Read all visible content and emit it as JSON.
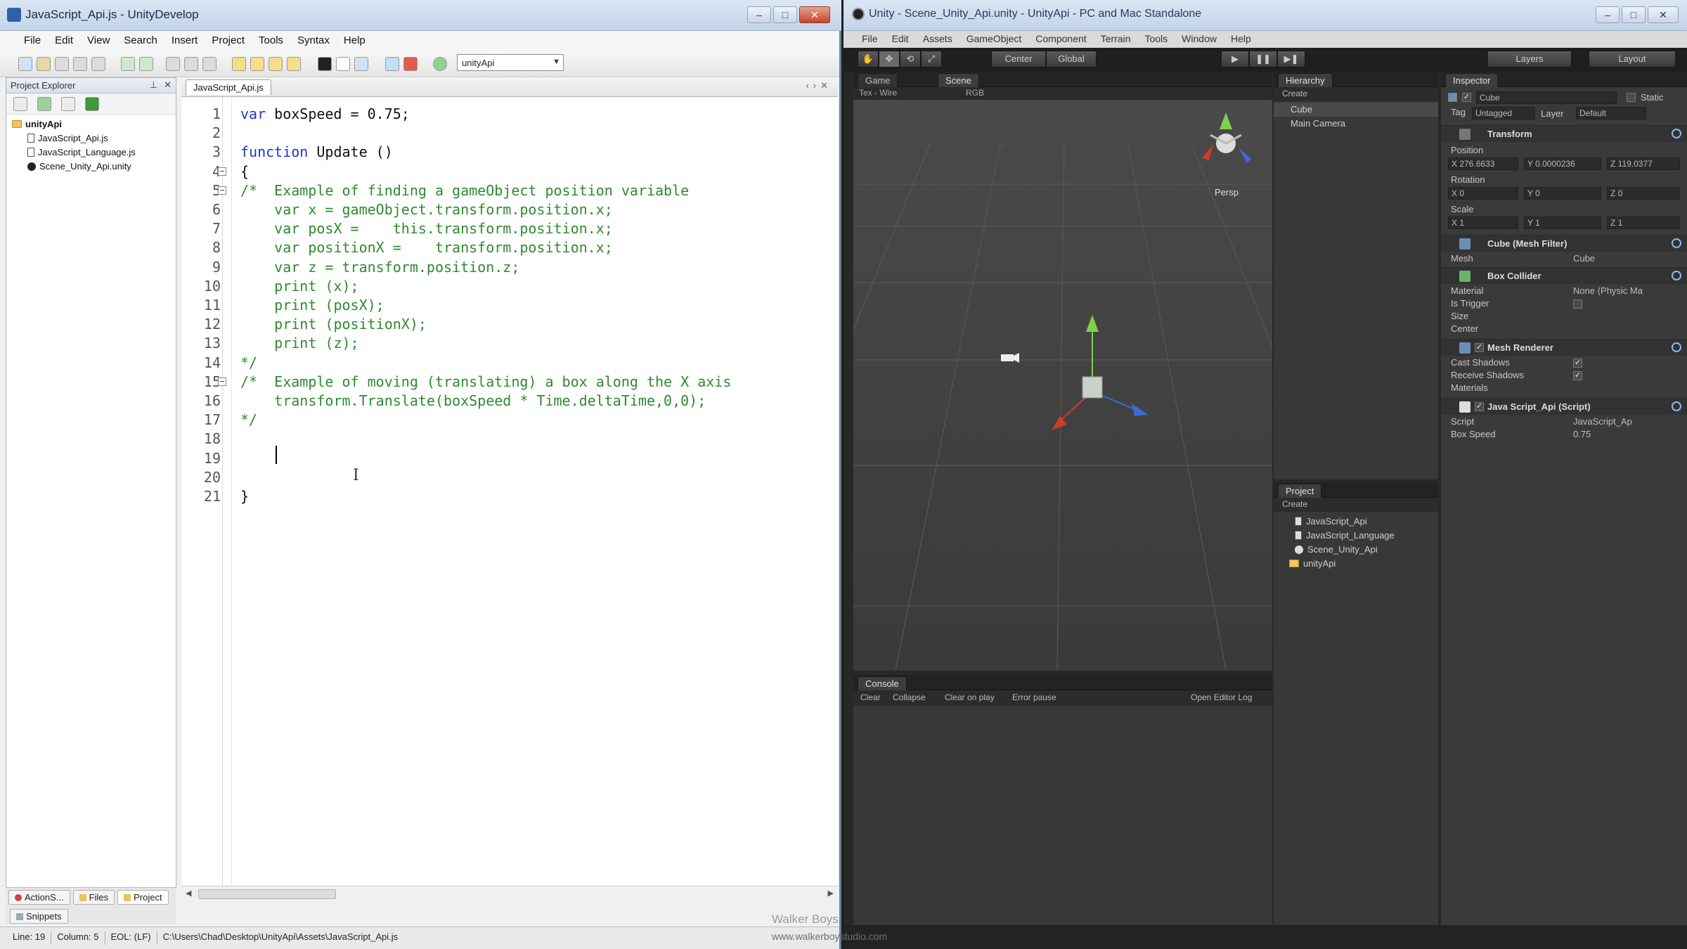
{
  "editor_window": {
    "title": "JavaScript_Api.js - UnityDevelop",
    "menu": [
      "File",
      "Edit",
      "View",
      "Search",
      "Insert",
      "Project",
      "Tools",
      "Syntax",
      "Help"
    ],
    "project_combo": "unityApi",
    "explorer": {
      "title": "Project Explorer",
      "items": [
        {
          "label": "unityApi",
          "type": "folder"
        },
        {
          "label": "JavaScript_Api.js",
          "type": "js"
        },
        {
          "label": "JavaScript_Language.js",
          "type": "js"
        },
        {
          "label": "Scene_Unity_Api.unity",
          "type": "unity"
        }
      ],
      "tabs": [
        "ActionS...",
        "Files",
        "Project"
      ],
      "snippets": "Snippets"
    },
    "tab": "JavaScript_Api.js",
    "code": [
      {
        "n": "1",
        "text": "var boxSpeed = 0.75;"
      },
      {
        "n": "2",
        "text": ""
      },
      {
        "n": "3",
        "text": "function Update ()"
      },
      {
        "n": "4",
        "text": "{"
      },
      {
        "n": "5",
        "text": "/*  Example of finding a gameObject position variable"
      },
      {
        "n": "6",
        "text": "    var x = gameObject.transform.position.x;"
      },
      {
        "n": "7",
        "text": "    var posX =    this.transform.position.x;"
      },
      {
        "n": "8",
        "text": "    var positionX =    transform.position.x;"
      },
      {
        "n": "9",
        "text": "    var z = transform.position.z;"
      },
      {
        "n": "10",
        "text": "    print (x);"
      },
      {
        "n": "11",
        "text": "    print (posX);"
      },
      {
        "n": "12",
        "text": "    print (positionX);"
      },
      {
        "n": "13",
        "text": "    print (z);"
      },
      {
        "n": "14",
        "text": "*/"
      },
      {
        "n": "15",
        "text": "/*  Example of moving (translating) a box along the X axis"
      },
      {
        "n": "16",
        "text": "    transform.Translate(boxSpeed * Time.deltaTime,0,0);"
      },
      {
        "n": "17",
        "text": "*/"
      },
      {
        "n": "18",
        "text": ""
      },
      {
        "n": "19",
        "text": ""
      },
      {
        "n": "20",
        "text": ""
      },
      {
        "n": "21",
        "text": "}"
      }
    ],
    "status": {
      "line": "Line: 19",
      "column": "Column: 5",
      "eol": "EOL: (LF)",
      "path": "C:\\Users\\Chad\\Desktop\\UnityApi\\Assets\\JavaScript_Api.js"
    }
  },
  "unity_window": {
    "title": "Unity - Scene_Unity_Api.unity - UnityApi - PC and Mac Standalone",
    "menu": [
      "File",
      "Edit",
      "Assets",
      "GameObject",
      "Component",
      "Terrain",
      "Tools",
      "Window",
      "Help"
    ],
    "toolbar": {
      "center": "Center",
      "global": "Global",
      "layers": "Layers",
      "layout": "Layout"
    },
    "scene_tabs": [
      "Game",
      "Scene"
    ],
    "scene_bar": "Tex - Wire",
    "scene_mode": "RGB",
    "persp_label": "Persp",
    "hierarchy": {
      "tab": "Hierarchy",
      "create": "Create",
      "items": [
        "Cube",
        "Main Camera"
      ]
    },
    "project": {
      "tab": "Project",
      "create": "Create",
      "items": [
        "JavaScript_Api",
        "JavaScript_Language",
        "Scene_Unity_Api",
        "unityApi"
      ]
    },
    "inspector": {
      "tab": "Inspector",
      "object_name": "Cube",
      "static_label": "Static",
      "tag_label": "Tag",
      "tag_value": "Untagged",
      "layer_label": "Layer",
      "layer_value": "Default",
      "transform": {
        "title": "Transform",
        "position_label": "Position",
        "position": [
          "X 276.6633",
          "Y 0.0000236",
          "Z 119.0377"
        ],
        "rotation_label": "Rotation",
        "rotation": [
          "X 0",
          "Y 0",
          "Z 0"
        ],
        "scale_label": "Scale",
        "scale": [
          "X 1",
          "Y 1",
          "Z 1"
        ]
      },
      "mesh_filter": {
        "title": "Cube (Mesh Filter)",
        "mesh_label": "Mesh",
        "mesh_value": "Cube"
      },
      "box_collider": {
        "title": "Box Collider",
        "material_label": "Material",
        "material_value": "None (Physic Ma",
        "trigger_label": "Is Trigger",
        "size_label": "Size",
        "center_label": "Center"
      },
      "mesh_renderer": {
        "title": "Mesh Renderer",
        "cast_label": "Cast Shadows",
        "receive_label": "Receive Shadows",
        "materials_label": "Materials"
      },
      "script": {
        "title": "Java Script_Api (Script)",
        "script_label": "Script",
        "script_value": "JavaScript_Ap",
        "speed_label": "Box Speed",
        "speed_value": "0.75"
      }
    },
    "console": {
      "tab": "Console",
      "clear": "Clear",
      "collapse": "Collapse",
      "clear_on_play": "Clear on play",
      "error_pause": "Error pause",
      "open_editor_log": "Open Editor Log"
    }
  },
  "watermark": {
    "line1": "Walker Boys",
    "line2": "www.walkerboystudio.com"
  },
  "colors": {
    "keyword": "#1b37c8",
    "comment": "#2f8a2f",
    "unity_bg": "#282828",
    "editor_bg": "#ffffff"
  }
}
